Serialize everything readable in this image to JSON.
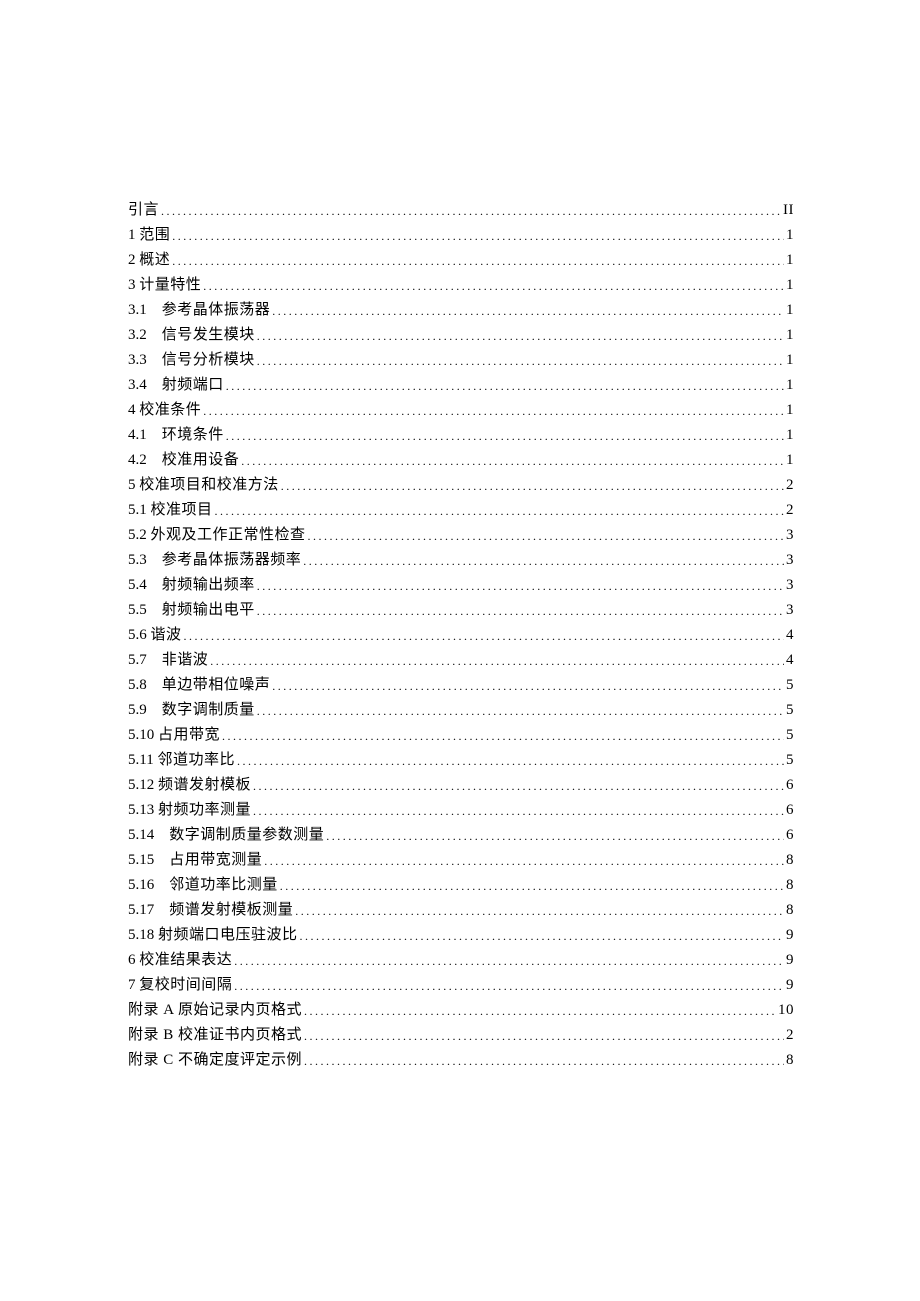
{
  "toc": [
    {
      "num": "",
      "gap": "",
      "title": "引言",
      "page": "II"
    },
    {
      "num": "1",
      "gap": " ",
      "title": "范围",
      "page": "1"
    },
    {
      "num": "2",
      "gap": " ",
      "title": "概述",
      "page": "1"
    },
    {
      "num": "3",
      "gap": " ",
      "title": "计量特性",
      "page": "1"
    },
    {
      "num": "3.1",
      "gap": "    ",
      "title": "参考晶体振荡器",
      "page": "1"
    },
    {
      "num": "3.2",
      "gap": "    ",
      "title": "信号发生模块",
      "page": "1"
    },
    {
      "num": "3.3",
      "gap": "    ",
      "title": "信号分析模块",
      "page": "1"
    },
    {
      "num": "3.4",
      "gap": "    ",
      "title": "射频端口",
      "page": "1"
    },
    {
      "num": "4",
      "gap": " ",
      "title": "校准条件",
      "page": "1"
    },
    {
      "num": "4.1",
      "gap": "    ",
      "title": "环境条件",
      "page": "1"
    },
    {
      "num": "4.2",
      "gap": "    ",
      "title": "校准用设备",
      "page": "1"
    },
    {
      "num": "5",
      "gap": " ",
      "title": "校准项目和校准方法",
      "page": "2"
    },
    {
      "num": "5.1",
      "gap": " ",
      "title": "校准项目",
      "page": "2"
    },
    {
      "num": "5.2",
      "gap": " ",
      "title": "外观及工作正常性检查",
      "page": "3"
    },
    {
      "num": "5.3",
      "gap": "    ",
      "title": "参考晶体振荡器频率",
      "page": "3"
    },
    {
      "num": "5.4",
      "gap": "    ",
      "title": "射频输出频率",
      "page": "3"
    },
    {
      "num": "5.5",
      "gap": "    ",
      "title": "射频输出电平",
      "page": "3"
    },
    {
      "num": "5.6",
      "gap": " ",
      "title": "谐波",
      "page": "4"
    },
    {
      "num": "5.7",
      "gap": "    ",
      "title": "非谐波",
      "page": "4"
    },
    {
      "num": "5.8",
      "gap": "    ",
      "title": "单边带相位噪声",
      "page": "5"
    },
    {
      "num": "5.9",
      "gap": "    ",
      "title": "数字调制质量",
      "page": "5"
    },
    {
      "num": "5.10",
      "gap": " ",
      "title": "占用带宽",
      "page": "5"
    },
    {
      "num": "5.11",
      "gap": " ",
      "title": "邻道功率比",
      "page": "5"
    },
    {
      "num": "5.12",
      "gap": " ",
      "title": "频谱发射模板",
      "page": "6"
    },
    {
      "num": "5.13",
      "gap": " ",
      "title": "射频功率测量",
      "page": "6"
    },
    {
      "num": "5.14",
      "gap": "    ",
      "title": "数字调制质量参数测量",
      "page": "6"
    },
    {
      "num": "5.15",
      "gap": "    ",
      "title": "占用带宽测量",
      "page": "8"
    },
    {
      "num": "5.16",
      "gap": "    ",
      "title": "邻道功率比测量",
      "page": "8"
    },
    {
      "num": "5.17",
      "gap": "    ",
      "title": "频谱发射模板测量",
      "page": "8"
    },
    {
      "num": "5.18",
      "gap": " ",
      "title": "射频端口电压驻波比",
      "page": "9"
    },
    {
      "num": "6",
      "gap": " ",
      "title": "校准结果表达",
      "page": "9"
    },
    {
      "num": "7",
      "gap": " ",
      "title": "复校时间间隔",
      "page": "9"
    },
    {
      "num": "",
      "gap": "",
      "title": "附录 A 原始记录内页格式",
      "page": "10"
    },
    {
      "num": "",
      "gap": "",
      "title": "附录 B 校准证书内页格式",
      "page": "2"
    },
    {
      "num": "",
      "gap": "",
      "title": "附录 C 不确定度评定示例",
      "page": "8"
    }
  ]
}
